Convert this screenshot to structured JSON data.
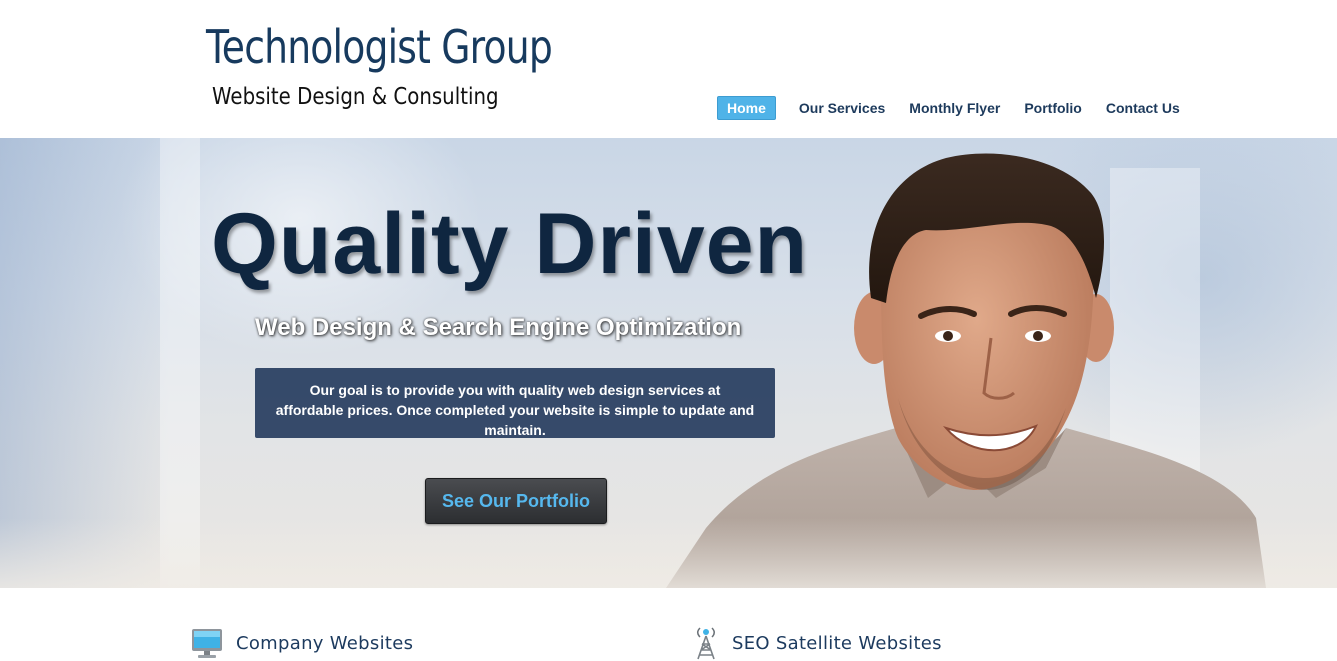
{
  "logo": {
    "title": "Technologist Group",
    "subtitle": "Website Design & Consulting"
  },
  "nav": {
    "items": [
      "Home",
      "Our Services",
      "Monthly Flyer",
      "Portfolio",
      "Contact Us"
    ],
    "active": "Home"
  },
  "hero": {
    "title": "Quality Driven",
    "subtitle": "Web Design & Search Engine Optimization",
    "description": "Our goal is to provide you with quality web design services at affordable prices. Once completed your website is simple to update and maintain.",
    "cta_label": "See Our Portfolio"
  },
  "features": [
    {
      "label": "Company Websites",
      "icon": "monitor-icon"
    },
    {
      "label": "SEO Satellite Websites",
      "icon": "antenna-tower-icon"
    }
  ],
  "colors": {
    "brand_navy": "#173a5e",
    "nav_active": "#4fb3e8",
    "cta_text": "#56b8ee",
    "hero_box": "#172f54"
  }
}
